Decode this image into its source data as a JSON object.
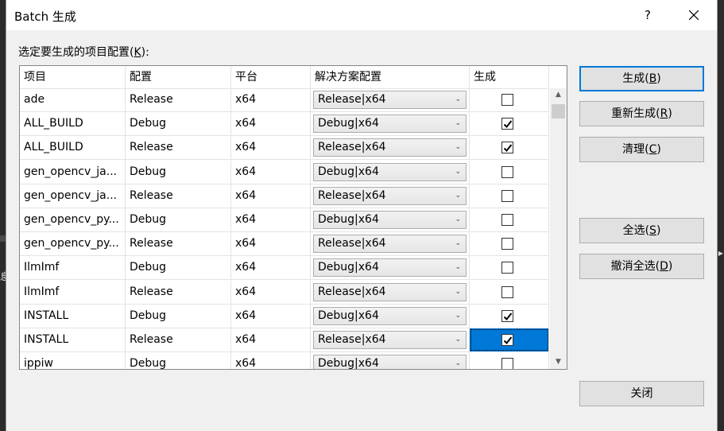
{
  "window": {
    "title": "Batch 生成",
    "help_label": "?"
  },
  "list": {
    "label_main": "选定要生成的项目配置(",
    "label_key": "K",
    "label_end": "):",
    "columns": [
      "项目",
      "配置",
      "平台",
      "解决方案配置",
      "生成"
    ],
    "rows": [
      {
        "project": "ade",
        "config": "Release",
        "platform": "x64",
        "solution_config": "Release|x64",
        "build": false
      },
      {
        "project": "ALL_BUILD",
        "config": "Debug",
        "platform": "x64",
        "solution_config": "Debug|x64",
        "build": true
      },
      {
        "project": "ALL_BUILD",
        "config": "Release",
        "platform": "x64",
        "solution_config": "Release|x64",
        "build": true
      },
      {
        "project": "gen_opencv_ja...",
        "config": "Debug",
        "platform": "x64",
        "solution_config": "Debug|x64",
        "build": false
      },
      {
        "project": "gen_opencv_ja...",
        "config": "Release",
        "platform": "x64",
        "solution_config": "Release|x64",
        "build": false
      },
      {
        "project": "gen_opencv_py...",
        "config": "Debug",
        "platform": "x64",
        "solution_config": "Debug|x64",
        "build": false
      },
      {
        "project": "gen_opencv_py...",
        "config": "Release",
        "platform": "x64",
        "solution_config": "Release|x64",
        "build": false
      },
      {
        "project": "IlmImf",
        "config": "Debug",
        "platform": "x64",
        "solution_config": "Debug|x64",
        "build": false
      },
      {
        "project": "IlmImf",
        "config": "Release",
        "platform": "x64",
        "solution_config": "Release|x64",
        "build": false
      },
      {
        "project": "INSTALL",
        "config": "Debug",
        "platform": "x64",
        "solution_config": "Debug|x64",
        "build": true
      },
      {
        "project": "INSTALL",
        "config": "Release",
        "platform": "x64",
        "solution_config": "Release|x64",
        "build": true,
        "selected": true
      },
      {
        "project": "ippiw",
        "config": "Debug",
        "platform": "x64",
        "solution_config": "Debug|x64",
        "build": false
      }
    ]
  },
  "buttons": {
    "build": {
      "label": "生成(",
      "key": "B",
      "end": ")"
    },
    "rebuild": {
      "label": "重新生成(",
      "key": "R",
      "end": ")"
    },
    "clean": {
      "label": "清理(",
      "key": "C",
      "end": ")"
    },
    "select_all": {
      "label": "全选(",
      "key": "S",
      "end": ")"
    },
    "deselect_all": {
      "label": "撤消全选(",
      "key": "D",
      "end": ")"
    },
    "close": {
      "label": "关闭"
    }
  },
  "background": {
    "left_glyph": "息"
  },
  "colors": {
    "selection": "#0078d7",
    "default_button_border": "#0078d7"
  }
}
